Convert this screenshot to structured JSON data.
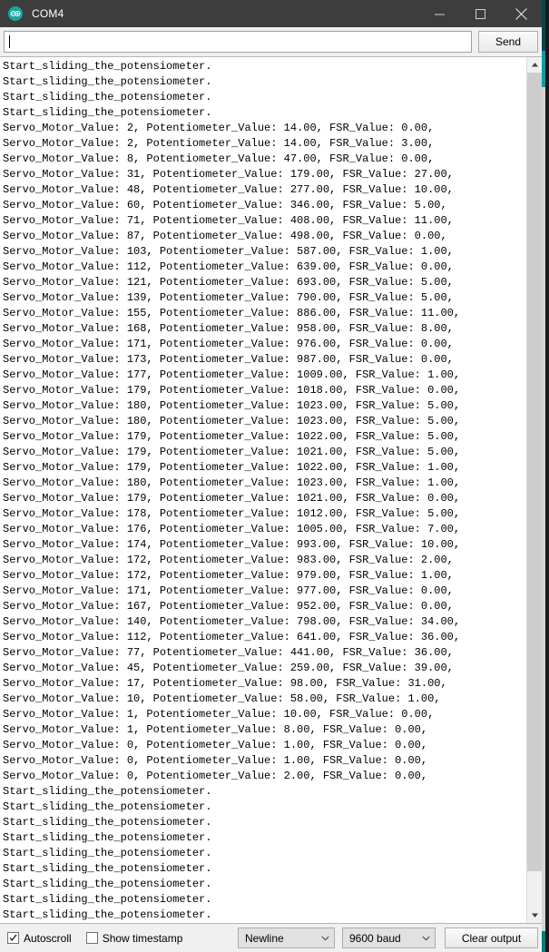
{
  "window": {
    "title": "COM4",
    "icon": "arduino-logo-icon",
    "minimize_label": "Minimize",
    "maximize_label": "Maximize",
    "close_label": "Close"
  },
  "send_row": {
    "input_value": "",
    "input_placeholder": "",
    "send_label": "Send"
  },
  "console": {
    "lines": [
      "Start_sliding_the_potensiometer.",
      "Start_sliding_the_potensiometer.",
      "Start_sliding_the_potensiometer.",
      "Start_sliding_the_potensiometer.",
      "Servo_Motor_Value: 2, Potentiometer_Value: 14.00, FSR_Value: 0.00,",
      "Servo_Motor_Value: 2, Potentiometer_Value: 14.00, FSR_Value: 3.00,",
      "Servo_Motor_Value: 8, Potentiometer_Value: 47.00, FSR_Value: 0.00,",
      "Servo_Motor_Value: 31, Potentiometer_Value: 179.00, FSR_Value: 27.00,",
      "Servo_Motor_Value: 48, Potentiometer_Value: 277.00, FSR_Value: 10.00,",
      "Servo_Motor_Value: 60, Potentiometer_Value: 346.00, FSR_Value: 5.00,",
      "Servo_Motor_Value: 71, Potentiometer_Value: 408.00, FSR_Value: 11.00,",
      "Servo_Motor_Value: 87, Potentiometer_Value: 498.00, FSR_Value: 0.00,",
      "Servo_Motor_Value: 103, Potentiometer_Value: 587.00, FSR_Value: 1.00,",
      "Servo_Motor_Value: 112, Potentiometer_Value: 639.00, FSR_Value: 0.00,",
      "Servo_Motor_Value: 121, Potentiometer_Value: 693.00, FSR_Value: 5.00,",
      "Servo_Motor_Value: 139, Potentiometer_Value: 790.00, FSR_Value: 5.00,",
      "Servo_Motor_Value: 155, Potentiometer_Value: 886.00, FSR_Value: 11.00,",
      "Servo_Motor_Value: 168, Potentiometer_Value: 958.00, FSR_Value: 8.00,",
      "Servo_Motor_Value: 171, Potentiometer_Value: 976.00, FSR_Value: 0.00,",
      "Servo_Motor_Value: 173, Potentiometer_Value: 987.00, FSR_Value: 0.00,",
      "Servo_Motor_Value: 177, Potentiometer_Value: 1009.00, FSR_Value: 1.00,",
      "Servo_Motor_Value: 179, Potentiometer_Value: 1018.00, FSR_Value: 0.00,",
      "Servo_Motor_Value: 180, Potentiometer_Value: 1023.00, FSR_Value: 5.00,",
      "Servo_Motor_Value: 180, Potentiometer_Value: 1023.00, FSR_Value: 5.00,",
      "Servo_Motor_Value: 179, Potentiometer_Value: 1022.00, FSR_Value: 5.00,",
      "Servo_Motor_Value: 179, Potentiometer_Value: 1021.00, FSR_Value: 5.00,",
      "Servo_Motor_Value: 179, Potentiometer_Value: 1022.00, FSR_Value: 1.00,",
      "Servo_Motor_Value: 180, Potentiometer_Value: 1023.00, FSR_Value: 1.00,",
      "Servo_Motor_Value: 179, Potentiometer_Value: 1021.00, FSR_Value: 0.00,",
      "Servo_Motor_Value: 178, Potentiometer_Value: 1012.00, FSR_Value: 5.00,",
      "Servo_Motor_Value: 176, Potentiometer_Value: 1005.00, FSR_Value: 7.00,",
      "Servo_Motor_Value: 174, Potentiometer_Value: 993.00, FSR_Value: 10.00,",
      "Servo_Motor_Value: 172, Potentiometer_Value: 983.00, FSR_Value: 2.00,",
      "Servo_Motor_Value: 172, Potentiometer_Value: 979.00, FSR_Value: 1.00,",
      "Servo_Motor_Value: 171, Potentiometer_Value: 977.00, FSR_Value: 0.00,",
      "Servo_Motor_Value: 167, Potentiometer_Value: 952.00, FSR_Value: 0.00,",
      "Servo_Motor_Value: 140, Potentiometer_Value: 798.00, FSR_Value: 34.00,",
      "Servo_Motor_Value: 112, Potentiometer_Value: 641.00, FSR_Value: 36.00,",
      "Servo_Motor_Value: 77, Potentiometer_Value: 441.00, FSR_Value: 36.00,",
      "Servo_Motor_Value: 45, Potentiometer_Value: 259.00, FSR_Value: 39.00,",
      "Servo_Motor_Value: 17, Potentiometer_Value: 98.00, FSR_Value: 31.00,",
      "Servo_Motor_Value: 10, Potentiometer_Value: 58.00, FSR_Value: 1.00,",
      "Servo_Motor_Value: 1, Potentiometer_Value: 10.00, FSR_Value: 0.00,",
      "Servo_Motor_Value: 1, Potentiometer_Value: 8.00, FSR_Value: 0.00,",
      "Servo_Motor_Value: 0, Potentiometer_Value: 1.00, FSR_Value: 0.00,",
      "Servo_Motor_Value: 0, Potentiometer_Value: 1.00, FSR_Value: 0.00,",
      "Servo_Motor_Value: 0, Potentiometer_Value: 2.00, FSR_Value: 0.00,",
      "Start_sliding_the_potensiometer.",
      "Start_sliding_the_potensiometer.",
      "Start_sliding_the_potensiometer.",
      "Start_sliding_the_potensiometer.",
      "Start_sliding_the_potensiometer.",
      "Start_sliding_the_potensiometer.",
      "Start_sliding_the_potensiometer.",
      "Start_sliding_the_potensiometer.",
      "Start_sliding_the_potensiometer."
    ]
  },
  "scrollbar": {
    "up_arrow": "chevron-up-icon",
    "down_arrow": "chevron-down-icon"
  },
  "statusbar": {
    "autoscroll_label": "Autoscroll",
    "autoscroll_checked": true,
    "show_timestamp_label": "Show timestamp",
    "show_timestamp_checked": false,
    "line_ending": "Newline",
    "baud_rate": "9600 baud",
    "clear_label": "Clear output"
  },
  "colors": {
    "titlebar_bg": "#3d3d3d",
    "window_bg": "#f0f0f0",
    "console_bg": "#ffffff",
    "console_text": "#000000",
    "arduino_teal": "#1aa6a0",
    "backdrop_teal": "#12494d"
  }
}
